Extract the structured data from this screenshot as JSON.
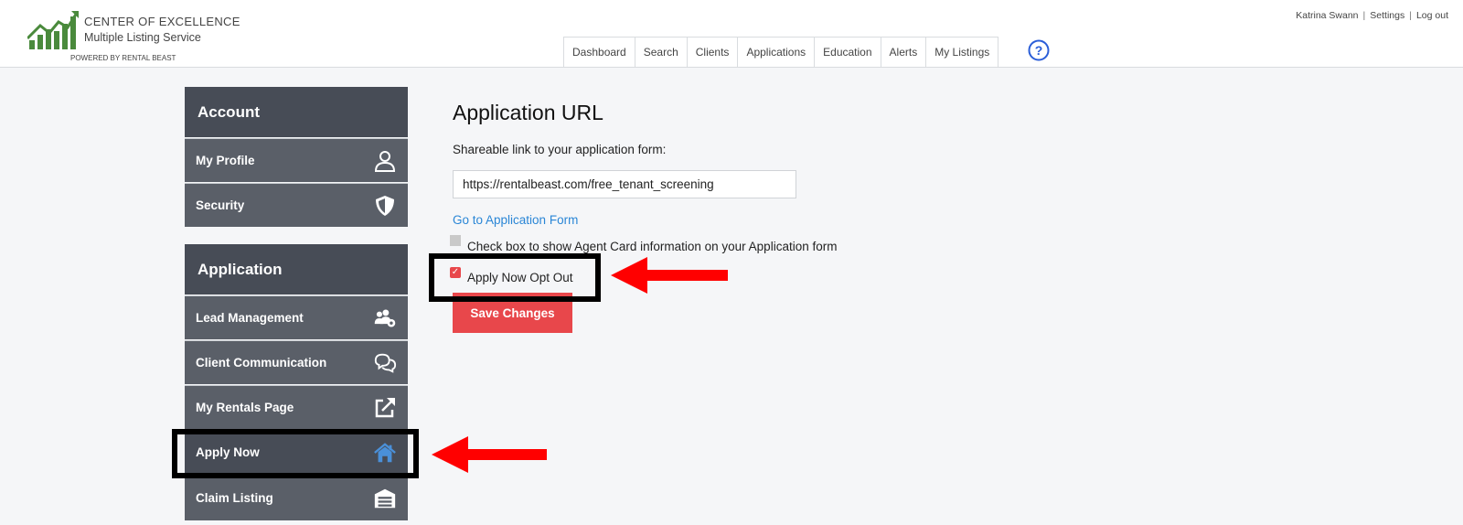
{
  "header": {
    "logo_line1": "CENTER OF  EXCELLENCE",
    "logo_line2": "Multiple Listing  Service",
    "logo_line3": "POWERED BY RENTAL BEAST",
    "user_name": "Katrina Swann",
    "settings_link": "Settings",
    "logout_link": "Log out",
    "nav_tabs": [
      "Dashboard",
      "Search",
      "Clients",
      "Applications",
      "Education",
      "Alerts",
      "My Listings"
    ],
    "help_icon": "question-circle-icon"
  },
  "sidebar": {
    "account_heading": "Account",
    "account_items": [
      {
        "label": "My Profile",
        "icon": "user-icon"
      },
      {
        "label": "Security",
        "icon": "shield-icon"
      }
    ],
    "application_heading": "Application",
    "application_items": [
      {
        "label": "Lead Management",
        "icon": "users-gear-icon"
      },
      {
        "label": "Client Communication",
        "icon": "chat-bubbles-icon"
      },
      {
        "label": "My Rentals Page",
        "icon": "external-link-icon"
      },
      {
        "label": "Apply Now",
        "icon": "house-icon",
        "active": true
      },
      {
        "label": "Claim Listing",
        "icon": "garage-icon"
      }
    ]
  },
  "main": {
    "title": "Application URL",
    "subtitle": "Shareable link to your application form:",
    "url_value": "https://rentalbeast.com/free_tenant_screening",
    "form_link": "Go to Application Form",
    "agent_card_checkbox_label": "Check box to show Agent Card information on your Application form",
    "agent_card_checked": false,
    "opt_out_checkbox_label": "Apply Now Opt Out",
    "opt_out_checked": true,
    "save_button": "Save Changes"
  },
  "colors": {
    "accent_red": "#e8474b",
    "sidebar_dark": "#474c56",
    "sidebar_item": "#5a5f68",
    "link_blue": "#2a86d6",
    "active_icon_blue": "#4a90d9",
    "logo_green": "#4a8a3c"
  }
}
